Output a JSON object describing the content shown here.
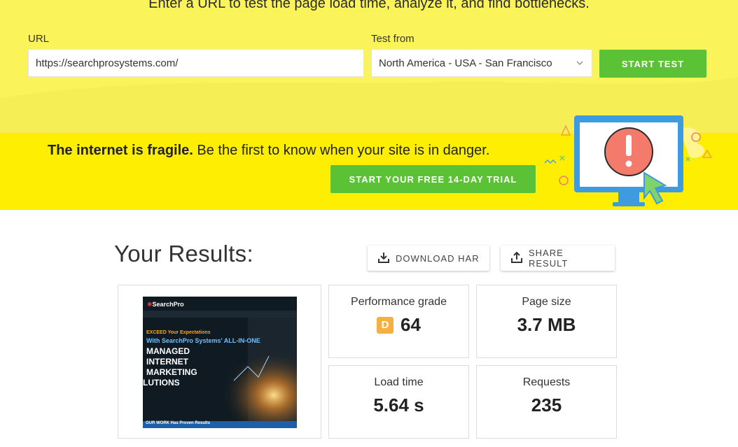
{
  "hero": {
    "subtitle": "Enter a URL to test the page load time, analyze it, and find bottlenecks.",
    "url_label": "URL",
    "url_value": "https://searchprosystems.com/",
    "test_from_label": "Test from",
    "test_from_value": "North America - USA - San Francisco",
    "start_test": "START TEST"
  },
  "promo": {
    "bold": "The internet is fragile.",
    "rest": " Be the first to know when your site is in danger.",
    "trial_button": "START YOUR FREE 14-DAY TRIAL"
  },
  "results": {
    "title": "Your Results:",
    "download_har": "DOWNLOAD HAR",
    "share_result": "SHARE RESULT",
    "thumbnail": {
      "logo": "SearchPro",
      "line1": "EXCEED Your Expectations",
      "line2": "With SearchPro Systems' ALL-IN-ONE",
      "line3": "MANAGED",
      "line4": "INTERNET",
      "line5": "MARKETING",
      "line6": "LUTIONS",
      "footer": "OUR WORK Has Proven Results"
    },
    "metrics": {
      "performance": {
        "label": "Performance grade",
        "grade": "D",
        "value": "64"
      },
      "page_size": {
        "label": "Page size",
        "value": "3.7 MB"
      },
      "load_time": {
        "label": "Load time",
        "value": "5.64 s"
      },
      "requests": {
        "label": "Requests",
        "value": "235"
      }
    }
  },
  "colors": {
    "hero_yellow": "#fbf35a",
    "promo_yellow": "#fdee02",
    "green": "#5bc236",
    "grade_orange": "#f5b041"
  }
}
